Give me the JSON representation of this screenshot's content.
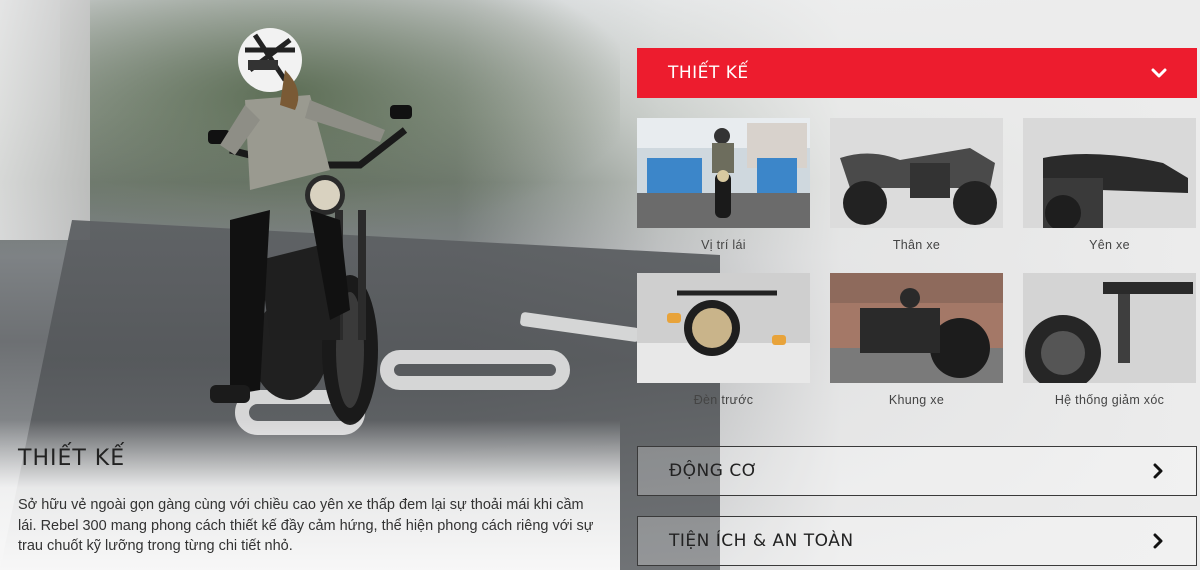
{
  "intro": {
    "title": "THIẾT KẾ",
    "description": "Sở hữu vẻ ngoài gọn gàng cùng với chiều cao yên xe thấp đem lại sự thoải mái khi cầm lái. Rebel 300 mang phong cách thiết kế đầy cảm hứng, thể hiện phong cách riêng với sự trau chuốt kỹ lưỡng trong từng chi tiết nhỏ."
  },
  "accordion": {
    "active": {
      "label": "THIẾT KẾ",
      "icon": "chevron-down-icon"
    },
    "tiles": [
      {
        "label": "Vị trí lái"
      },
      {
        "label": "Thân xe"
      },
      {
        "label": "Yên xe"
      },
      {
        "label": "Đèn trước"
      },
      {
        "label": "Khung xe"
      },
      {
        "label": "Hệ thống giảm xóc"
      }
    ],
    "sections": [
      {
        "label": "ĐỘNG CƠ",
        "icon": "chevron-right-icon"
      },
      {
        "label": "TIỆN ÍCH & AN TOÀN",
        "icon": "chevron-right-icon"
      }
    ]
  },
  "colors": {
    "accent": "#ed1c2e",
    "text": "#222222"
  }
}
